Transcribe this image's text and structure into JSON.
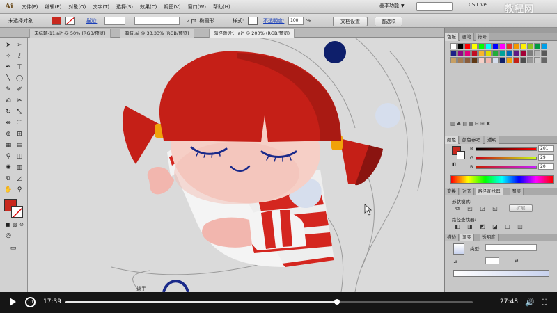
{
  "app": {
    "logo": "Ai",
    "menus": [
      "文件(F)",
      "编辑(E)",
      "对象(O)",
      "文字(T)",
      "选择(S)",
      "效果(C)",
      "视图(V)",
      "窗口(W)",
      "帮助(H)"
    ],
    "workspace": "基本功能",
    "cs_live": "CS Live",
    "watermark": "教程网"
  },
  "control_bar": {
    "selection_status": "未选择对象",
    "stroke_label": "描边:",
    "brush_value": "2 pt. 椭圆形",
    "style_label": "样式:",
    "opacity_label": "不透明度:",
    "opacity_value": "100",
    "opacity_unit": "%",
    "doc_setup_button": "文档设置",
    "preferences_button": "首选项"
  },
  "doc_tabs": [
    {
      "label": "未标题-11.ai* @ 50% (RGB/预览)"
    },
    {
      "label": "瀚音.ai @ 33.33% (RGB/预览)"
    },
    {
      "label": "萌怪兽设计.ai* @ 200% (RGB/预览)"
    }
  ],
  "panels": {
    "swatches_tabs": [
      "色板",
      "画笔",
      "符号"
    ],
    "color_tabs": [
      "颜色",
      "颜色参考",
      "透明"
    ],
    "color": {
      "fill_color": "#c8281e",
      "channels": [
        {
          "label": "R",
          "value": "201"
        },
        {
          "label": "G",
          "value": "29"
        },
        {
          "label": "B",
          "value": "20"
        }
      ]
    },
    "pathfinder_tabs": [
      "变换",
      "对齐",
      "路径查找器",
      "图层"
    ],
    "shape_modes_label": "形状模式:",
    "expand_button": "扩展",
    "pathfinders_label": "路径查找器:",
    "gradient_tabs": [
      "描边",
      "渐变",
      "透明度"
    ],
    "gradient_type_label": "类型:"
  },
  "canvas_label": "拨手",
  "video": {
    "current_time": "17:39",
    "total_time": "27:48",
    "progress": 0.666
  },
  "colors": {
    "hair": "#c51f17",
    "skin": "#f6cfc6",
    "sleeve_red": "#d4261f",
    "navy_dot": "#0e1f6b",
    "light_dot": "#d6deed",
    "tie": "#f0a20a"
  }
}
